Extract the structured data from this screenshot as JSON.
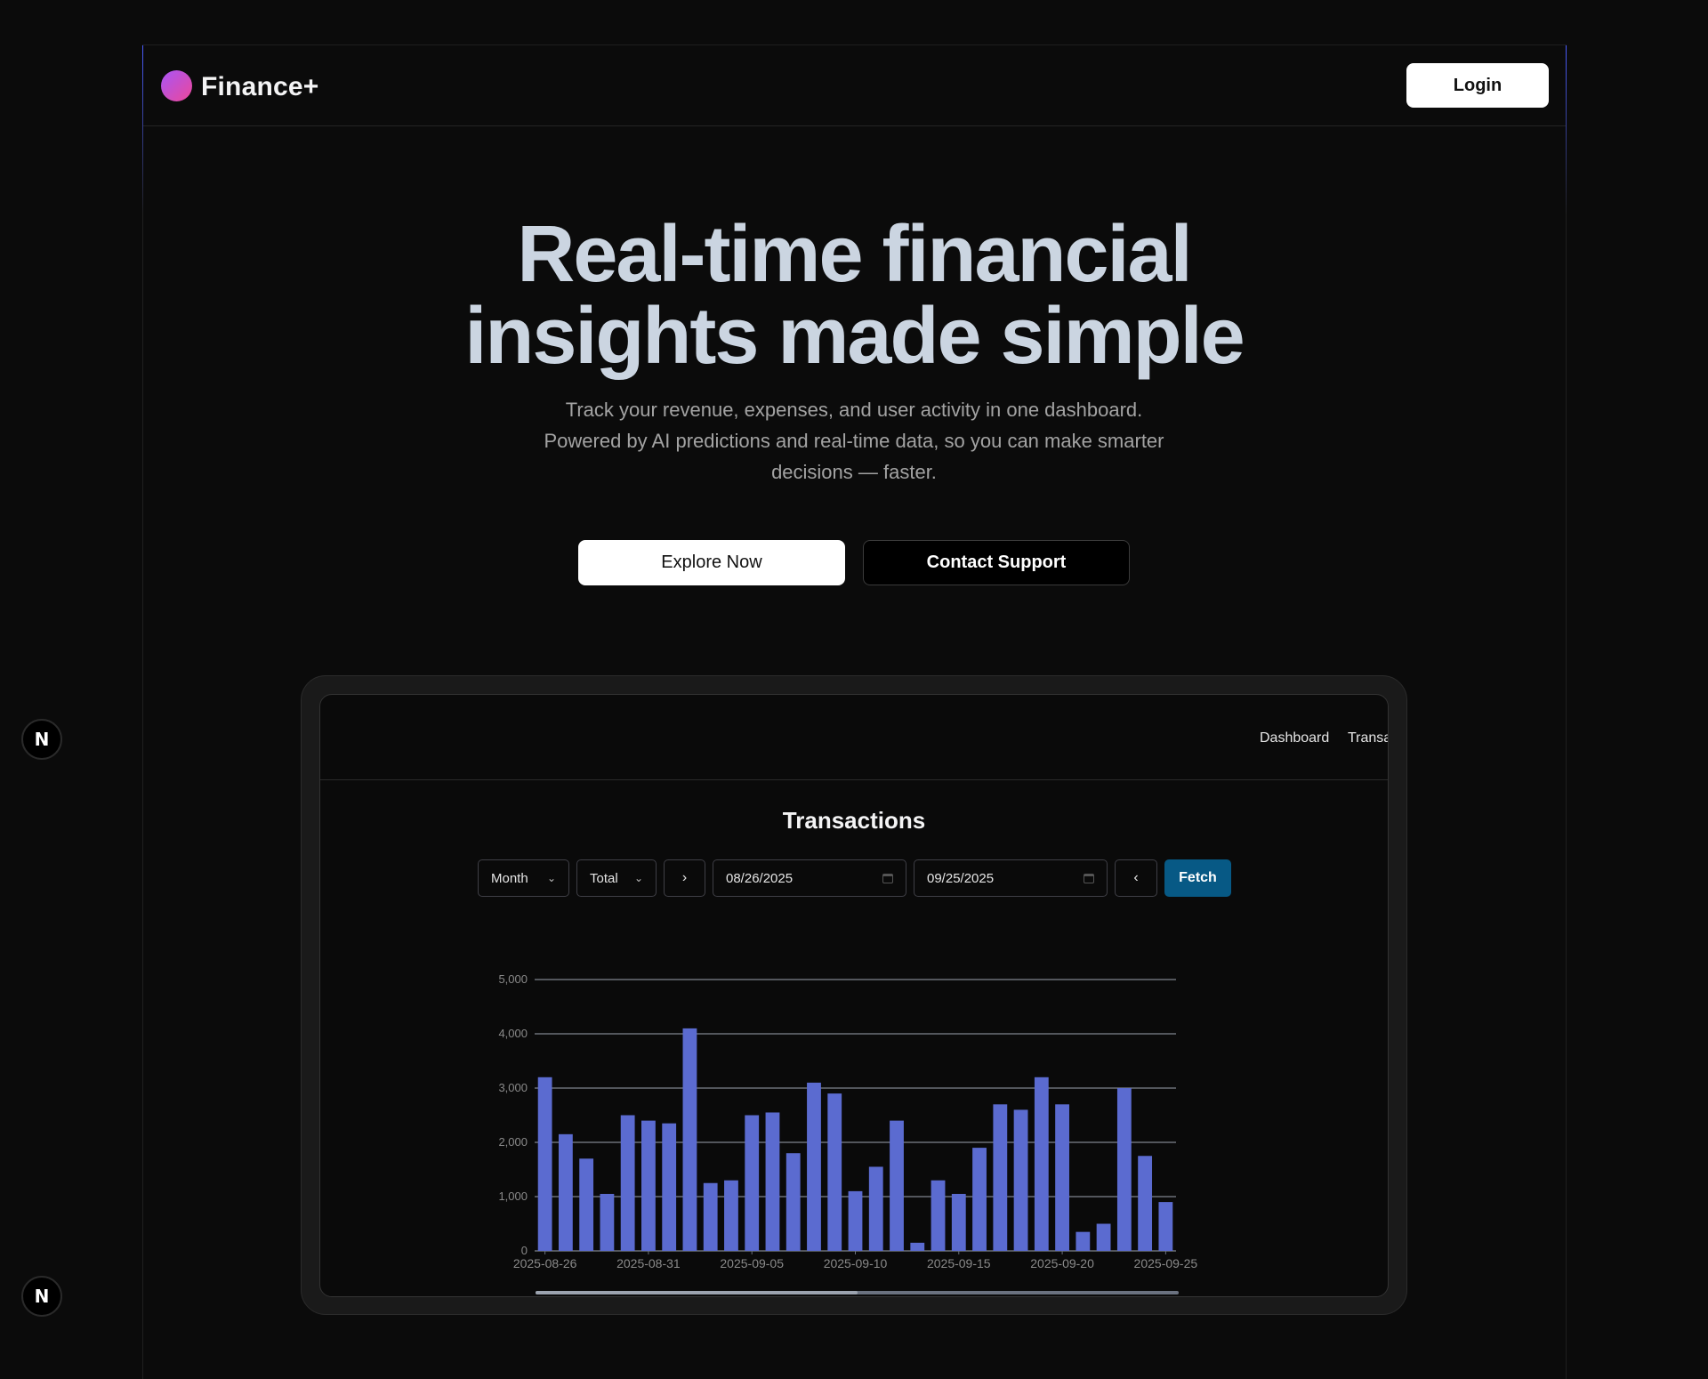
{
  "brand": {
    "name": "Finance+",
    "logo_colors": [
      "#a855f7",
      "#ec4899"
    ]
  },
  "nav": {
    "login_label": "Login"
  },
  "hero": {
    "title_line1": "Real-time financial",
    "title_line2": "insights made simple",
    "subtitle_line1": "Track your revenue, expenses, and user activity in one dashboard.",
    "subtitle_line2": "Powered by AI predictions and real-time data, so you can make smarter",
    "subtitle_line3": "decisions — faster.",
    "primary_cta": "Explore Now",
    "secondary_cta": "Contact Support"
  },
  "preview": {
    "nav_links": [
      "Dashboard",
      "Transa"
    ],
    "title": "Transactions",
    "controls": {
      "period": "Month",
      "metric": "Total",
      "next_icon": "chevron-right-icon",
      "start_date": "08/26/2025",
      "end_date": "09/25/2025",
      "prev_icon": "chevron-left-icon",
      "fetch_label": "Fetch",
      "fetch_color": "#075985"
    }
  },
  "dev_badges": [
    "N",
    "N"
  ],
  "chart_data": {
    "type": "bar",
    "title": "",
    "xlabel": "",
    "ylabel": "",
    "ylim": [
      0,
      5000
    ],
    "yticks": [
      "0",
      "1,000",
      "2,000",
      "3,000",
      "4,000",
      "5,000"
    ],
    "xticks": [
      "2025-08-26",
      "2025-08-31",
      "2025-09-05",
      "2025-09-10",
      "2025-09-15",
      "2025-09-20",
      "2025-09-25"
    ],
    "bar_color": "#5b6bd0",
    "grid": true,
    "categories": [
      "2025-08-26",
      "2025-08-27",
      "2025-08-28",
      "2025-08-29",
      "2025-08-30",
      "2025-08-31",
      "2025-09-01",
      "2025-09-02",
      "2025-09-03",
      "2025-09-04",
      "2025-09-05",
      "2025-09-06",
      "2025-09-07",
      "2025-09-08",
      "2025-09-09",
      "2025-09-10",
      "2025-09-11",
      "2025-09-12",
      "2025-09-13",
      "2025-09-14",
      "2025-09-15",
      "2025-09-16",
      "2025-09-17",
      "2025-09-18",
      "2025-09-19",
      "2025-09-20",
      "2025-09-21",
      "2025-09-22",
      "2025-09-23",
      "2025-09-24",
      "2025-09-25"
    ],
    "values": [
      3200,
      2150,
      1700,
      1050,
      2500,
      2400,
      2350,
      4100,
      1250,
      1300,
      2500,
      2550,
      1800,
      3100,
      2900,
      1100,
      1550,
      2400,
      150,
      1300,
      1050,
      1900,
      2700,
      2600,
      3200,
      2700,
      350,
      500,
      3000,
      1750,
      900
    ]
  }
}
